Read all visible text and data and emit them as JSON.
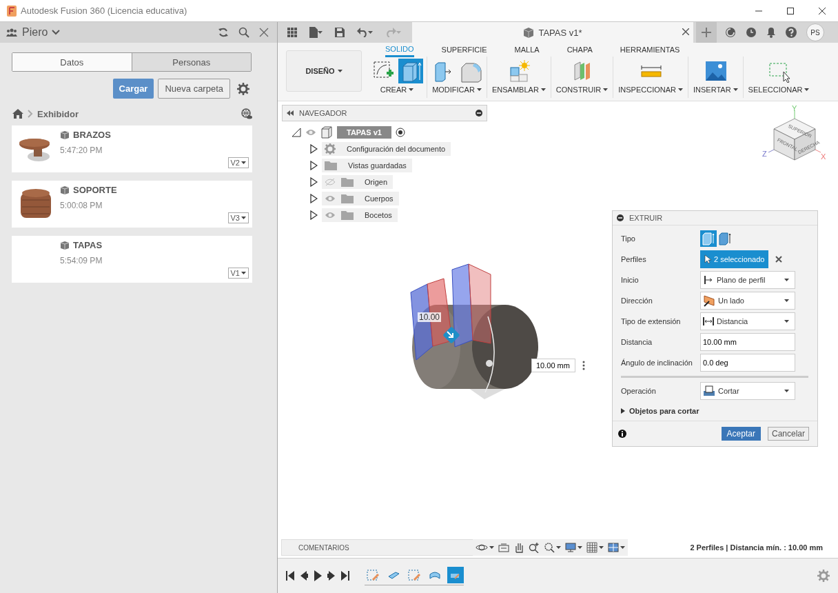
{
  "window": {
    "title": "Autodesk Fusion 360 (Licencia educativa)"
  },
  "data_panel": {
    "user": "Piero",
    "tabs": [
      {
        "label": "Datos",
        "selected": true
      },
      {
        "label": "Personas",
        "selected": false
      }
    ],
    "upload_button": "Cargar",
    "new_folder_button": "Nueva carpeta",
    "breadcrumb": "Exhibidor",
    "files": [
      {
        "name": "BRAZOS",
        "time": "5:47:20 PM",
        "version": "V2",
        "kind": "disc"
      },
      {
        "name": "SOPORTE",
        "time": "5:00:08 PM",
        "version": "V3",
        "kind": "jar"
      },
      {
        "name": "TAPAS",
        "time": "5:54:09 PM",
        "version": "V1",
        "kind": "blank"
      }
    ]
  },
  "toolbar": {
    "document_tab": "TAPAS v1*",
    "avatar": "PS"
  },
  "ribbon": {
    "workspace": "DISEÑO",
    "tabs": [
      {
        "label": "SOLIDO",
        "selected": true
      },
      {
        "label": "SUPERFICIE",
        "selected": false
      },
      {
        "label": "MALLA",
        "selected": false
      },
      {
        "label": "CHAPA",
        "selected": false
      },
      {
        "label": "HERRAMIENTAS",
        "selected": false
      }
    ],
    "groups": [
      {
        "label": "CREAR",
        "tools": [
          {
            "kind": "sketch",
            "active": false
          },
          {
            "kind": "extrude",
            "active": true
          }
        ]
      },
      {
        "label": "MODIFICAR",
        "tools": [
          {
            "kind": "presspull",
            "active": false
          },
          {
            "kind": "fillet",
            "active": false
          }
        ]
      },
      {
        "label": "ENSAMBLAR",
        "tools": [
          {
            "kind": "component",
            "active": false
          }
        ]
      },
      {
        "label": "CONSTRUIR",
        "tools": [
          {
            "kind": "plane",
            "active": false
          }
        ]
      },
      {
        "label": "INSPECCIONAR",
        "tools": [
          {
            "kind": "ruler",
            "active": false
          }
        ]
      },
      {
        "label": "INSERTAR",
        "tools": [
          {
            "kind": "image",
            "active": false
          }
        ]
      },
      {
        "label": "SELECCIONAR",
        "tools": [
          {
            "kind": "select",
            "active": false
          }
        ]
      }
    ]
  },
  "browser": {
    "title": "NAVEGADOR",
    "root": {
      "label": "TAPAS v1",
      "expanded": true,
      "children": [
        {
          "label": "Configuración del documento",
          "kind": "settings",
          "expanded": false
        },
        {
          "label": "Vistas guardadas",
          "kind": "folder",
          "expanded": false
        },
        {
          "label": "Origen",
          "kind": "folder",
          "visible": false,
          "expanded": false
        },
        {
          "label": "Cuerpos",
          "kind": "folder",
          "visible": true,
          "expanded": false
        },
        {
          "label": "Bocetos",
          "kind": "sketches",
          "visible": true,
          "expanded": false
        }
      ]
    }
  },
  "viewcube": {
    "faces": [
      "SUPERIOR",
      "FRONTAL",
      "DERECHA"
    ],
    "axes": [
      "Y",
      "Z",
      "X"
    ]
  },
  "model": {
    "label": "10.00"
  },
  "dimension_input": {
    "value": "10.00 mm"
  },
  "extrude_dialog": {
    "title": "EXTRUIR",
    "rows": [
      {
        "label": "Tipo",
        "kind": "choice",
        "options": [
          {
            "kind": "solid",
            "selected": true
          },
          {
            "kind": "thin",
            "selected": false
          }
        ]
      },
      {
        "label": "Perfiles",
        "kind": "selection",
        "value": "2 seleccionado"
      },
      {
        "label": "Inicio",
        "kind": "start",
        "value": "Plano de perfil"
      },
      {
        "label": "Dirección",
        "kind": "direction",
        "value": "Un lado"
      },
      {
        "label": "Tipo de extensión",
        "kind": "extent",
        "value": "Distancia"
      },
      {
        "label": "Distancia",
        "kind": "input",
        "value": "10.00 mm"
      },
      {
        "label": "Ángulo de inclinación",
        "kind": "input",
        "value": "0.0 deg"
      },
      {
        "kind": "divider"
      },
      {
        "label": "Operación",
        "kind": "operation",
        "value": "Cortar"
      }
    ],
    "section": {
      "label": "Objetos para cortar",
      "expanded": false
    },
    "ok": "Aceptar",
    "cancel": "Cancelar"
  },
  "comments": {
    "label": "COMENTARIOS"
  },
  "status": "2 Perfiles | Distancia mín. : 10.00 mm",
  "timeline": {
    "features": [
      {
        "kind": "sketch",
        "selected": false
      },
      {
        "kind": "body",
        "selected": false
      },
      {
        "kind": "sketch",
        "selected": false
      },
      {
        "kind": "extrude",
        "selected": false
      },
      {
        "kind": "cut",
        "selected": true
      }
    ]
  }
}
